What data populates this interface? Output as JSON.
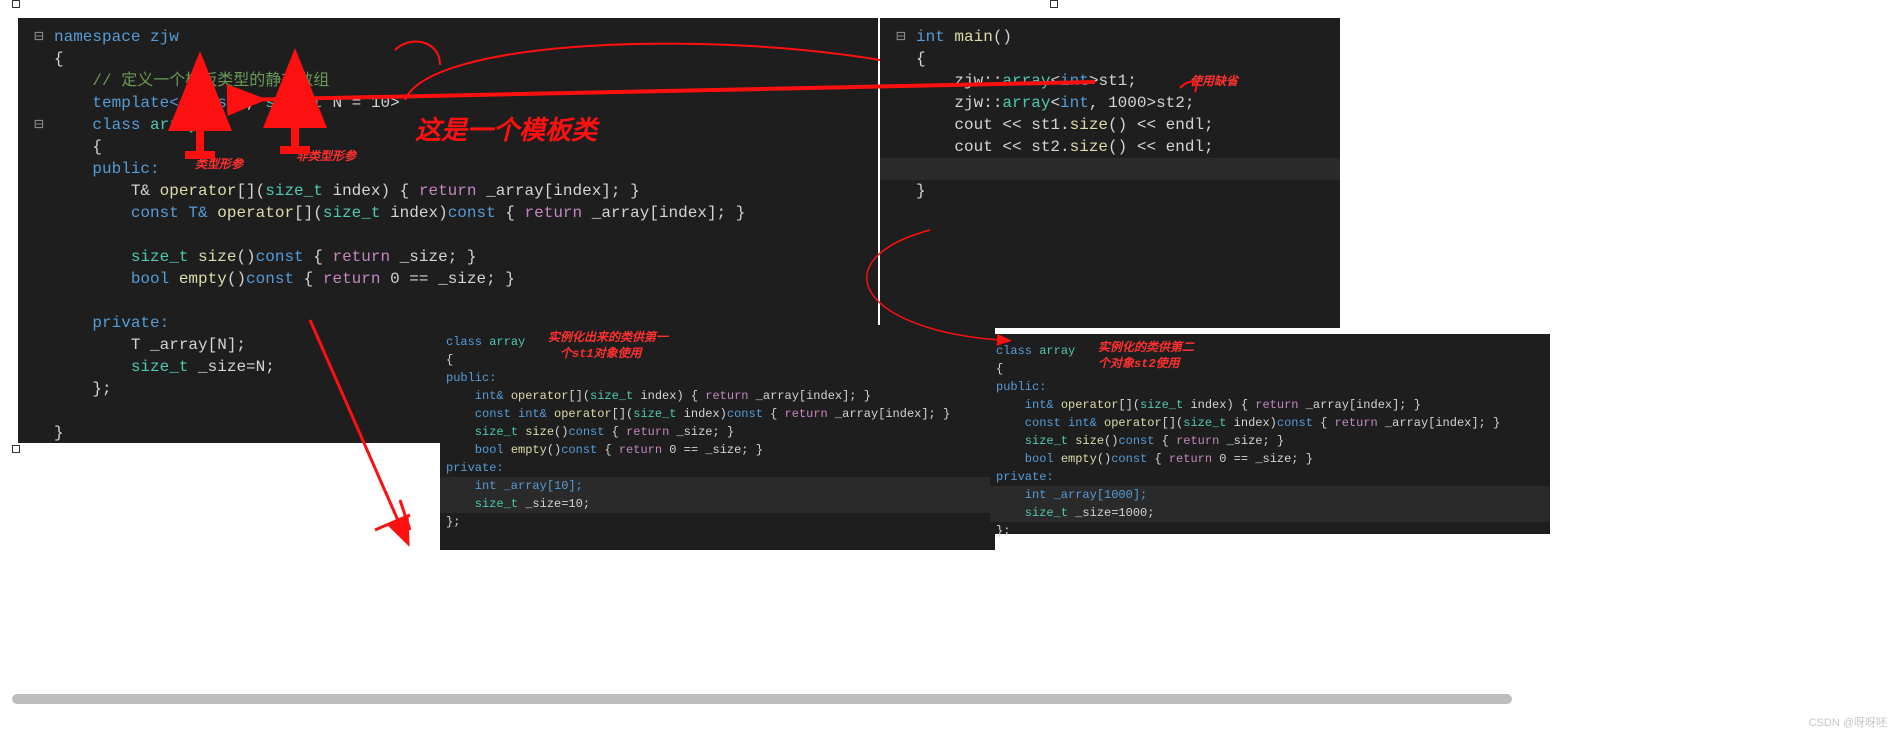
{
  "editor1": {
    "l1": "namespace zjw",
    "l2": "{",
    "l3": "    // 定义一个模板类型的静态数组",
    "l4a": "    template<",
    "l4b": "class",
    "l4c": " T, ",
    "l4d": "size_t",
    "l4e": " N = 10>",
    "l5a": "    class ",
    "l5b": "array",
    "l6": "    {",
    "l7": "    public:",
    "l8a": "        T& ",
    "l8b": "operator",
    "l8c": "[](",
    "l8d": "size_t",
    "l8e": " index) { ",
    "l8f": "return",
    "l8g": " _array[index]; }",
    "l9a": "        const T& ",
    "l9b": "operator",
    "l9c": "[](",
    "l9d": "size_t",
    "l9e": " index)",
    "l9f": "const",
    "l9g": " { ",
    "l9h": "return",
    "l9i": " _array[index]; }",
    "l10": "",
    "l11a": "        size_t ",
    "l11b": "size",
    "l11c": "()",
    "l11d": "const",
    "l11e": " { ",
    "l11f": "return",
    "l11g": " _size; }",
    "l12a": "        bool ",
    "l12b": "empty",
    "l12c": "()",
    "l12d": "const",
    "l12e": " { ",
    "l12f": "return",
    "l12g": " 0 == _size; }",
    "l13": "",
    "l14": "    private:",
    "l15": "        T _array[N];",
    "l16a": "        size_t ",
    "l16b": "_size=N;",
    "l17": "    };",
    "l18": "",
    "l19": "}"
  },
  "editor2": {
    "l1a": "int ",
    "l1b": "main",
    "l1c": "()",
    "l2": "{",
    "l3a": "    zjw::",
    "l3b": "array",
    "l3c": "<",
    "l3d": "int",
    "l3e": ">st1;",
    "l4a": "    zjw::",
    "l4b": "array",
    "l4c": "<",
    "l4d": "int",
    "l4e": ", 1000>st2;",
    "l5a": "    cout << st1.",
    "l5b": "size",
    "l5c": "() << endl;",
    "l6a": "    cout << st2.",
    "l6b": "size",
    "l6c": "() << endl;",
    "l7": "",
    "l8": "}"
  },
  "inst1": {
    "l1a": "class ",
    "l1b": "array",
    "l2": "{",
    "l3": "public:",
    "l4a": "    int& ",
    "l4b": "operator",
    "l4c": "[](",
    "l4d": "size_t",
    "l4e": " index) { ",
    "l4f": "return",
    "l4g": " _array[index]; }",
    "l5a": "    const int& ",
    "l5b": "operator",
    "l5c": "[](",
    "l5d": "size_t",
    "l5e": " index)",
    "l5f": "const",
    "l5g": " { ",
    "l5h": "return",
    "l5i": " _array[index]; }",
    "l6": "",
    "l7a": "    size_t ",
    "l7b": "size",
    "l7c": "()",
    "l7d": "const",
    "l7e": " { ",
    "l7f": "return",
    "l7g": " _size; }",
    "l8a": "    bool ",
    "l8b": "empty",
    "l8c": "()",
    "l8d": "const",
    "l8e": " { ",
    "l8f": "return",
    "l8g": " 0 == _size; }",
    "l9": "",
    "l10": "private:",
    "l11": "    int _array[10];",
    "l12a": "    size_t ",
    "l12b": "_size=10;",
    "l13": "};"
  },
  "inst2": {
    "l1a": "class ",
    "l1b": "array",
    "l2": "{",
    "l3": "public:",
    "l4a": "    int& ",
    "l4b": "operator",
    "l4c": "[](",
    "l4d": "size_t",
    "l4e": " index) { ",
    "l4f": "return",
    "l4g": " _array[index]; }",
    "l5a": "    const int& ",
    "l5b": "operator",
    "l5c": "[](",
    "l5d": "size_t",
    "l5e": " index)",
    "l5f": "const",
    "l5g": " { ",
    "l5h": "return",
    "l5i": " _array[index]; }",
    "l6": "",
    "l7a": "    size_t ",
    "l7b": "size",
    "l7c": "()",
    "l7d": "const",
    "l7e": " { ",
    "l7f": "return",
    "l7g": " _size; }",
    "l8a": "    bool ",
    "l8b": "empty",
    "l8c": "()",
    "l8d": "const",
    "l8e": " { ",
    "l8f": "return",
    "l8g": " 0 == _size; }",
    "l9": "",
    "l10": "private:",
    "l11": "    int _array[1000];",
    "l12a": "    size_t ",
    "l12b": "_size=1000;",
    "l13": "};"
  },
  "anno": {
    "big": "这是一个模板类",
    "typearg": "类型形参",
    "nontypearg": "非类型形参",
    "default": "使用缺省",
    "inst1a": "实例化出来的类供第一",
    "inst1b": "个st1对象使用",
    "inst2a": "实例化的类供第二",
    "inst2b": "个对象st2使用"
  },
  "watermark": "CSDN @呀呀呸"
}
